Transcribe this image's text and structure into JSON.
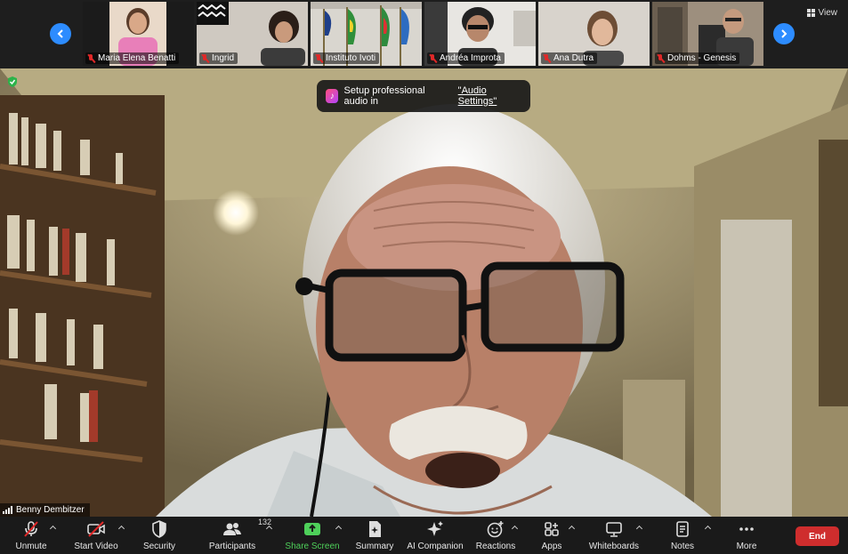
{
  "gallery": {
    "view_label": "View",
    "prev_icon": "chevron-left-icon",
    "next_icon": "chevron-right-icon",
    "tiles": [
      {
        "name": "Maria Elena Benatti",
        "muted": true
      },
      {
        "name": "Ingrid",
        "muted": true
      },
      {
        "name": "Instituto Ivoti",
        "muted": true
      },
      {
        "name": "Andréa Improta",
        "muted": true
      },
      {
        "name": "Ana Dutra",
        "muted": true
      },
      {
        "name": "Dohms - Genesis",
        "muted": true
      }
    ]
  },
  "main_video": {
    "speaker_name": "Benny Dembitzer",
    "banner": {
      "text": "Setup professional audio in",
      "link": "\"Audio Settings\""
    }
  },
  "toolbar": {
    "unmute": "Unmute",
    "start_video": "Start Video",
    "security": "Security",
    "participants": "Participants",
    "participants_count": "132",
    "share_screen": "Share Screen",
    "summary": "Summary",
    "ai_companion": "AI Companion",
    "reactions": "Reactions",
    "apps": "Apps",
    "whiteboards": "Whiteboards",
    "notes": "Notes",
    "more": "More",
    "end": "End"
  },
  "colors": {
    "accent_blue": "#2d8cff",
    "end_red": "#cf2d2d",
    "share_green": "#4ed05a",
    "mute_red": "#e02828"
  }
}
